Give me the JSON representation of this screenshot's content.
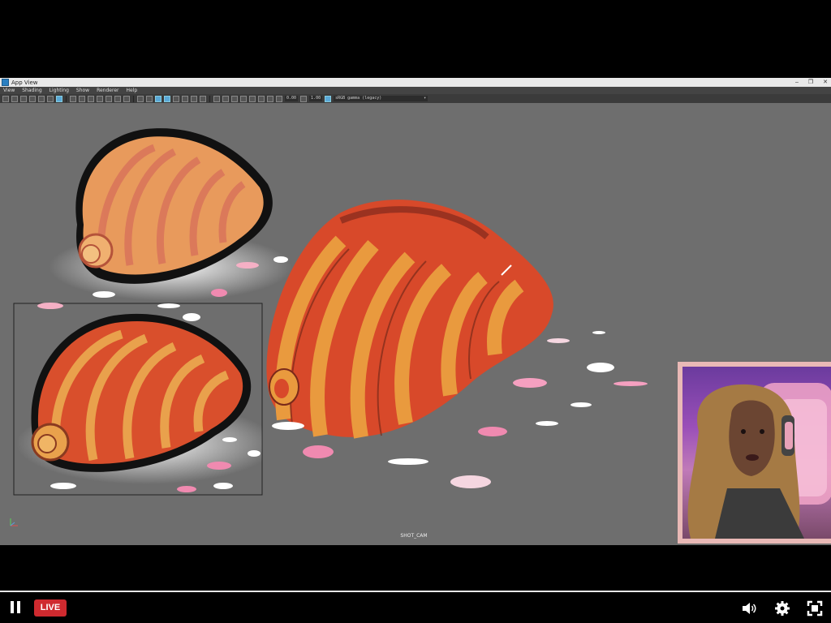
{
  "window": {
    "title": "App View",
    "controls": [
      "–",
      "❐",
      "✕"
    ]
  },
  "menu": {
    "items": [
      "View",
      "Shading",
      "Lighting",
      "Show",
      "Renderer",
      "Help"
    ]
  },
  "toolbar": {
    "exposure_value": "0.00",
    "gamma_value": "1.00",
    "color_space": "sRGB gamma (legacy)"
  },
  "viewport": {
    "camera_label": "SHOT_CAM"
  },
  "player": {
    "live_label": "LIVE",
    "icons": [
      "pause-icon",
      "volume-icon",
      "settings-icon",
      "fullscreen-icon"
    ]
  },
  "colors": {
    "viewport_bg": "#6e6e6e",
    "live_red": "#cf2a2f",
    "croissant_orange": "#e0582a",
    "croissant_light": "#eaa24a",
    "petal_pink": "#f08ab0"
  }
}
